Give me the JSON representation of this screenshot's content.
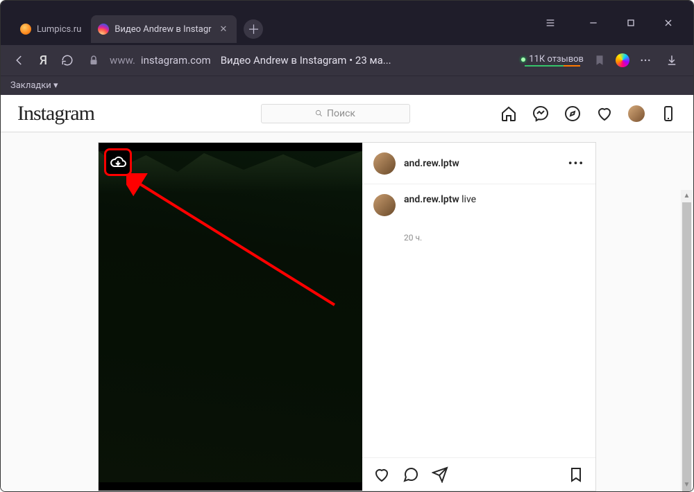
{
  "browser": {
    "tabs": [
      {
        "title": "Lumpics.ru",
        "favicon": "orange",
        "active": false
      },
      {
        "title": "Видео Andrew в Instagr",
        "favicon": "ig",
        "active": true
      }
    ],
    "url": {
      "host_prefix": "www.",
      "host": "instagram.com",
      "title_suffix": "Видео Andrew в Instagram • 23 ма..."
    },
    "reviews": "11К отзывов",
    "bookmarks_label": "Закладки ▾"
  },
  "instagram": {
    "logo": "Instagram",
    "search_placeholder": "Поиск",
    "post": {
      "author": "and.rew.lptw",
      "caption_author": "and.rew.lptw",
      "caption_text": "live",
      "timestamp": "20 ч."
    }
  },
  "annotation": {
    "download_icon": "download-from-cloud"
  }
}
